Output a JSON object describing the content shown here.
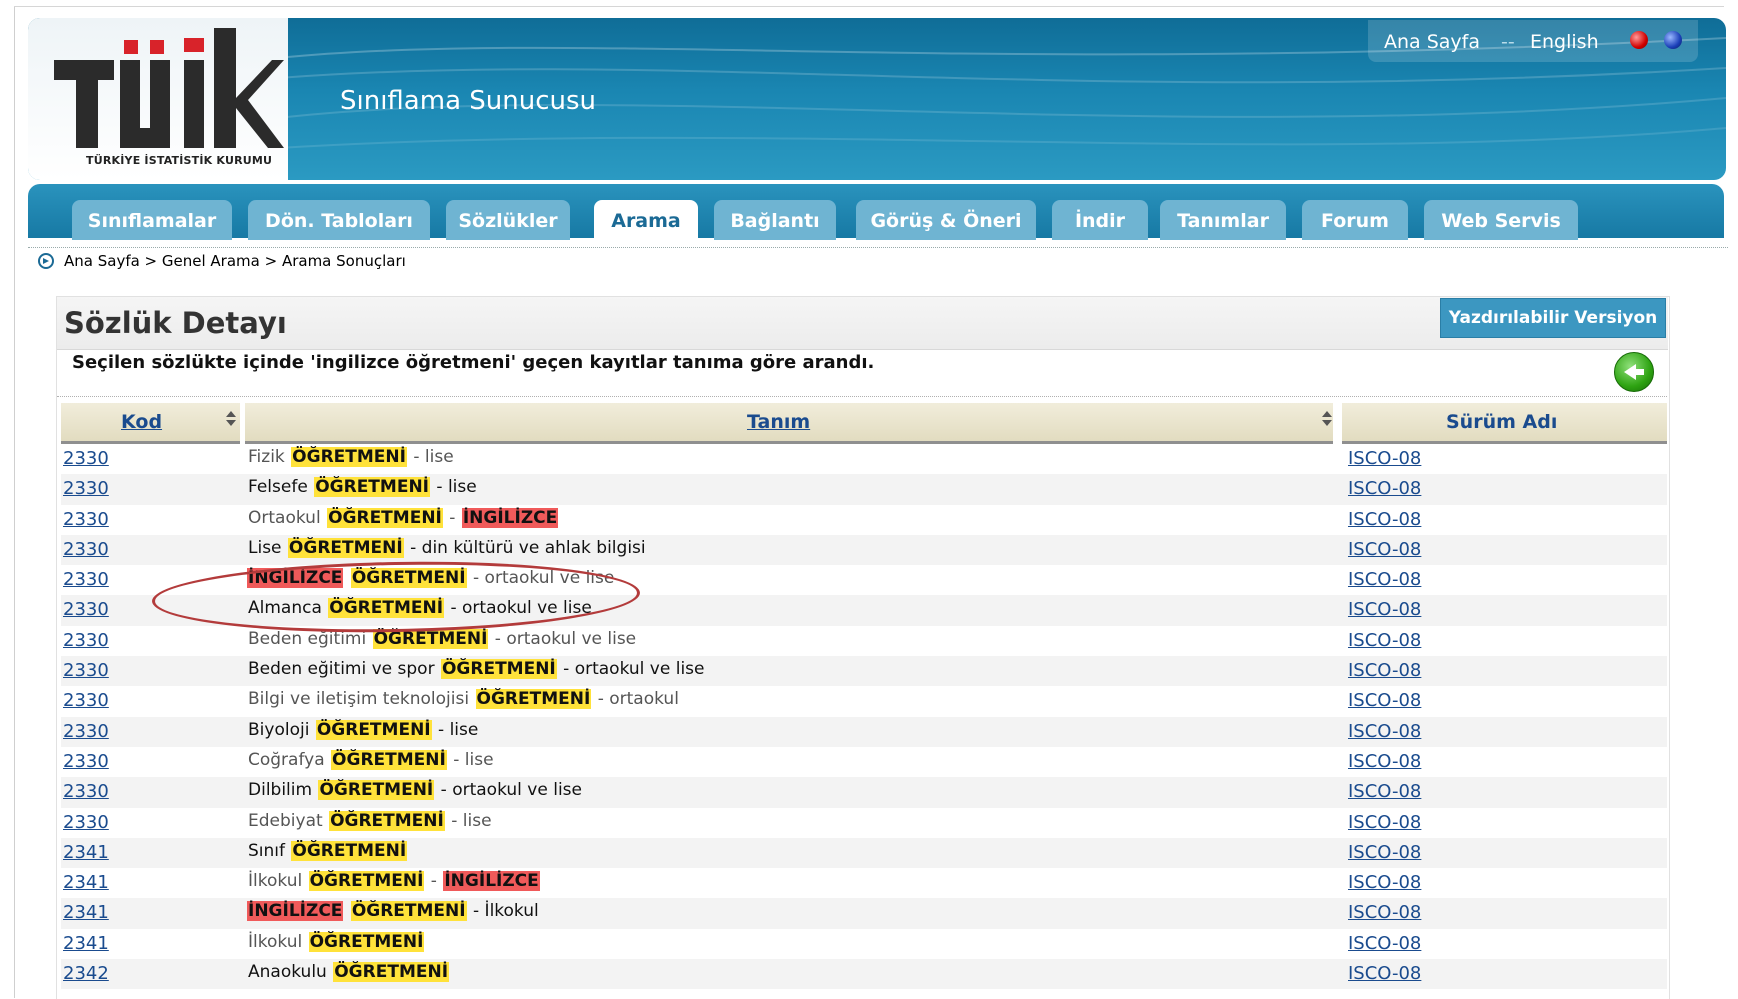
{
  "header": {
    "logo_text": "TÜİK",
    "logo_caption": "TÜRKİYE İSTATİSTİK KURUMU",
    "site_title": "Sınıflama Sunucusu",
    "links": {
      "home": "Ana Sayfa",
      "separator": "--",
      "english": "English"
    },
    "colors": {
      "header_dark": "#0f6d97",
      "header_light": "#2b9ac2"
    }
  },
  "nav": {
    "tabs": [
      {
        "label": "Sınıflamalar",
        "active": false
      },
      {
        "label": "Dön. Tabloları",
        "active": false
      },
      {
        "label": "Sözlükler",
        "active": false
      },
      {
        "label": "Arama",
        "active": true
      },
      {
        "label": "Bağlantı",
        "active": false
      },
      {
        "label": "Görüş & Öneri",
        "active": false
      },
      {
        "label": "İndir",
        "active": false
      },
      {
        "label": "Tanımlar",
        "active": false
      },
      {
        "label": "Forum",
        "active": false
      },
      {
        "label": "Web Servis",
        "active": false
      }
    ]
  },
  "breadcrumb": {
    "text": "Ana Sayfa > Genel Arama > Arama Sonuçları"
  },
  "panel": {
    "title": "Sözlük Detayı",
    "print_label": "Yazdırılabilir Versiyon",
    "description": "Seçilen sözlükte içinde 'ingilizce öğretmeni' geçen kayıtlar tanıma göre arandı."
  },
  "table": {
    "headers": {
      "kod": "Kod",
      "tanim": "Tanım",
      "surum": "Sürüm Adı"
    },
    "highlight_colors": {
      "match": "#ffe23a",
      "secondary_match": "#f05a5a"
    },
    "rows": [
      {
        "kod": "2330",
        "tone": "gray",
        "parts": [
          [
            "Fizik ",
            ""
          ],
          [
            "ÖĞRETMENİ",
            "y"
          ],
          [
            " - lise",
            ""
          ]
        ],
        "surum": "ISCO-08"
      },
      {
        "kod": "2330",
        "tone": "dark",
        "parts": [
          [
            "Felsefe ",
            ""
          ],
          [
            "ÖĞRETMENİ",
            "y"
          ],
          [
            " - lise",
            ""
          ]
        ],
        "surum": "ISCO-08"
      },
      {
        "kod": "2330",
        "tone": "gray",
        "parts": [
          [
            "Ortaokul ",
            ""
          ],
          [
            "ÖĞRETMENİ",
            "y"
          ],
          [
            " - ",
            ""
          ],
          [
            "İNGİLİZCE",
            "r"
          ]
        ],
        "surum": "ISCO-08"
      },
      {
        "kod": "2330",
        "tone": "dark",
        "parts": [
          [
            "Lise ",
            ""
          ],
          [
            "ÖĞRETMENİ",
            "y"
          ],
          [
            " - din kültürü ve ahlak bilgisi",
            ""
          ]
        ],
        "surum": "ISCO-08"
      },
      {
        "kod": "2330",
        "tone": "gray",
        "parts": [
          [
            "İNGİLİZCE",
            "r"
          ],
          [
            " ",
            ""
          ],
          [
            "ÖĞRETMENİ",
            "y"
          ],
          [
            " - ortaokul ve lise",
            ""
          ]
        ],
        "surum": "ISCO-08"
      },
      {
        "kod": "2330",
        "tone": "dark",
        "parts": [
          [
            "Almanca ",
            ""
          ],
          [
            "ÖĞRETMENİ",
            "y"
          ],
          [
            " - ortaokul ve lise",
            ""
          ]
        ],
        "surum": "ISCO-08"
      },
      {
        "kod": "2330",
        "tone": "gray",
        "parts": [
          [
            "Beden eğitimi ",
            ""
          ],
          [
            "ÖĞRETMENİ",
            "y"
          ],
          [
            " - ortaokul ve lise",
            ""
          ]
        ],
        "surum": "ISCO-08"
      },
      {
        "kod": "2330",
        "tone": "dark",
        "parts": [
          [
            "Beden eğitimi ve spor ",
            ""
          ],
          [
            "ÖĞRETMENİ",
            "y"
          ],
          [
            " - ortaokul ve lise",
            ""
          ]
        ],
        "surum": "ISCO-08"
      },
      {
        "kod": "2330",
        "tone": "gray",
        "parts": [
          [
            "Bilgi ve iletişim teknolojisi ",
            ""
          ],
          [
            "ÖĞRETMENİ",
            "y"
          ],
          [
            " - ortaokul",
            ""
          ]
        ],
        "surum": "ISCO-08"
      },
      {
        "kod": "2330",
        "tone": "dark",
        "parts": [
          [
            "Biyoloji ",
            ""
          ],
          [
            "ÖĞRETMENİ",
            "y"
          ],
          [
            " - lise",
            ""
          ]
        ],
        "surum": "ISCO-08"
      },
      {
        "kod": "2330",
        "tone": "gray",
        "parts": [
          [
            "Coğrafya ",
            ""
          ],
          [
            "ÖĞRETMENİ",
            "y"
          ],
          [
            " - lise",
            ""
          ]
        ],
        "surum": "ISCO-08"
      },
      {
        "kod": "2330",
        "tone": "dark",
        "parts": [
          [
            "Dilbilim ",
            ""
          ],
          [
            "ÖĞRETMENİ",
            "y"
          ],
          [
            " - ortaokul ve lise",
            ""
          ]
        ],
        "surum": "ISCO-08"
      },
      {
        "kod": "2330",
        "tone": "gray",
        "parts": [
          [
            "Edebiyat ",
            ""
          ],
          [
            "ÖĞRETMENİ",
            "y"
          ],
          [
            " - lise",
            ""
          ]
        ],
        "surum": "ISCO-08"
      },
      {
        "kod": "2341",
        "tone": "dark",
        "parts": [
          [
            "Sınıf ",
            ""
          ],
          [
            "ÖĞRETMENİ",
            "y"
          ]
        ],
        "surum": "ISCO-08"
      },
      {
        "kod": "2341",
        "tone": "gray",
        "parts": [
          [
            "İlkokul ",
            ""
          ],
          [
            "ÖĞRETMENİ",
            "y"
          ],
          [
            " - ",
            ""
          ],
          [
            "İNGİLİZCE",
            "r"
          ]
        ],
        "surum": "ISCO-08"
      },
      {
        "kod": "2341",
        "tone": "dark",
        "parts": [
          [
            "İNGİLİZCE",
            "r"
          ],
          [
            " ",
            ""
          ],
          [
            "ÖĞRETMENİ",
            "y"
          ],
          [
            " - İlkokul",
            ""
          ]
        ],
        "surum": "ISCO-08"
      },
      {
        "kod": "2341",
        "tone": "gray",
        "parts": [
          [
            "İlkokul ",
            ""
          ],
          [
            "ÖĞRETMENİ",
            "y"
          ]
        ],
        "surum": "ISCO-08"
      },
      {
        "kod": "2342",
        "tone": "dark",
        "parts": [
          [
            "Anaokulu ",
            ""
          ],
          [
            "ÖĞRETMENİ",
            "y"
          ]
        ],
        "surum": "ISCO-08"
      }
    ]
  }
}
